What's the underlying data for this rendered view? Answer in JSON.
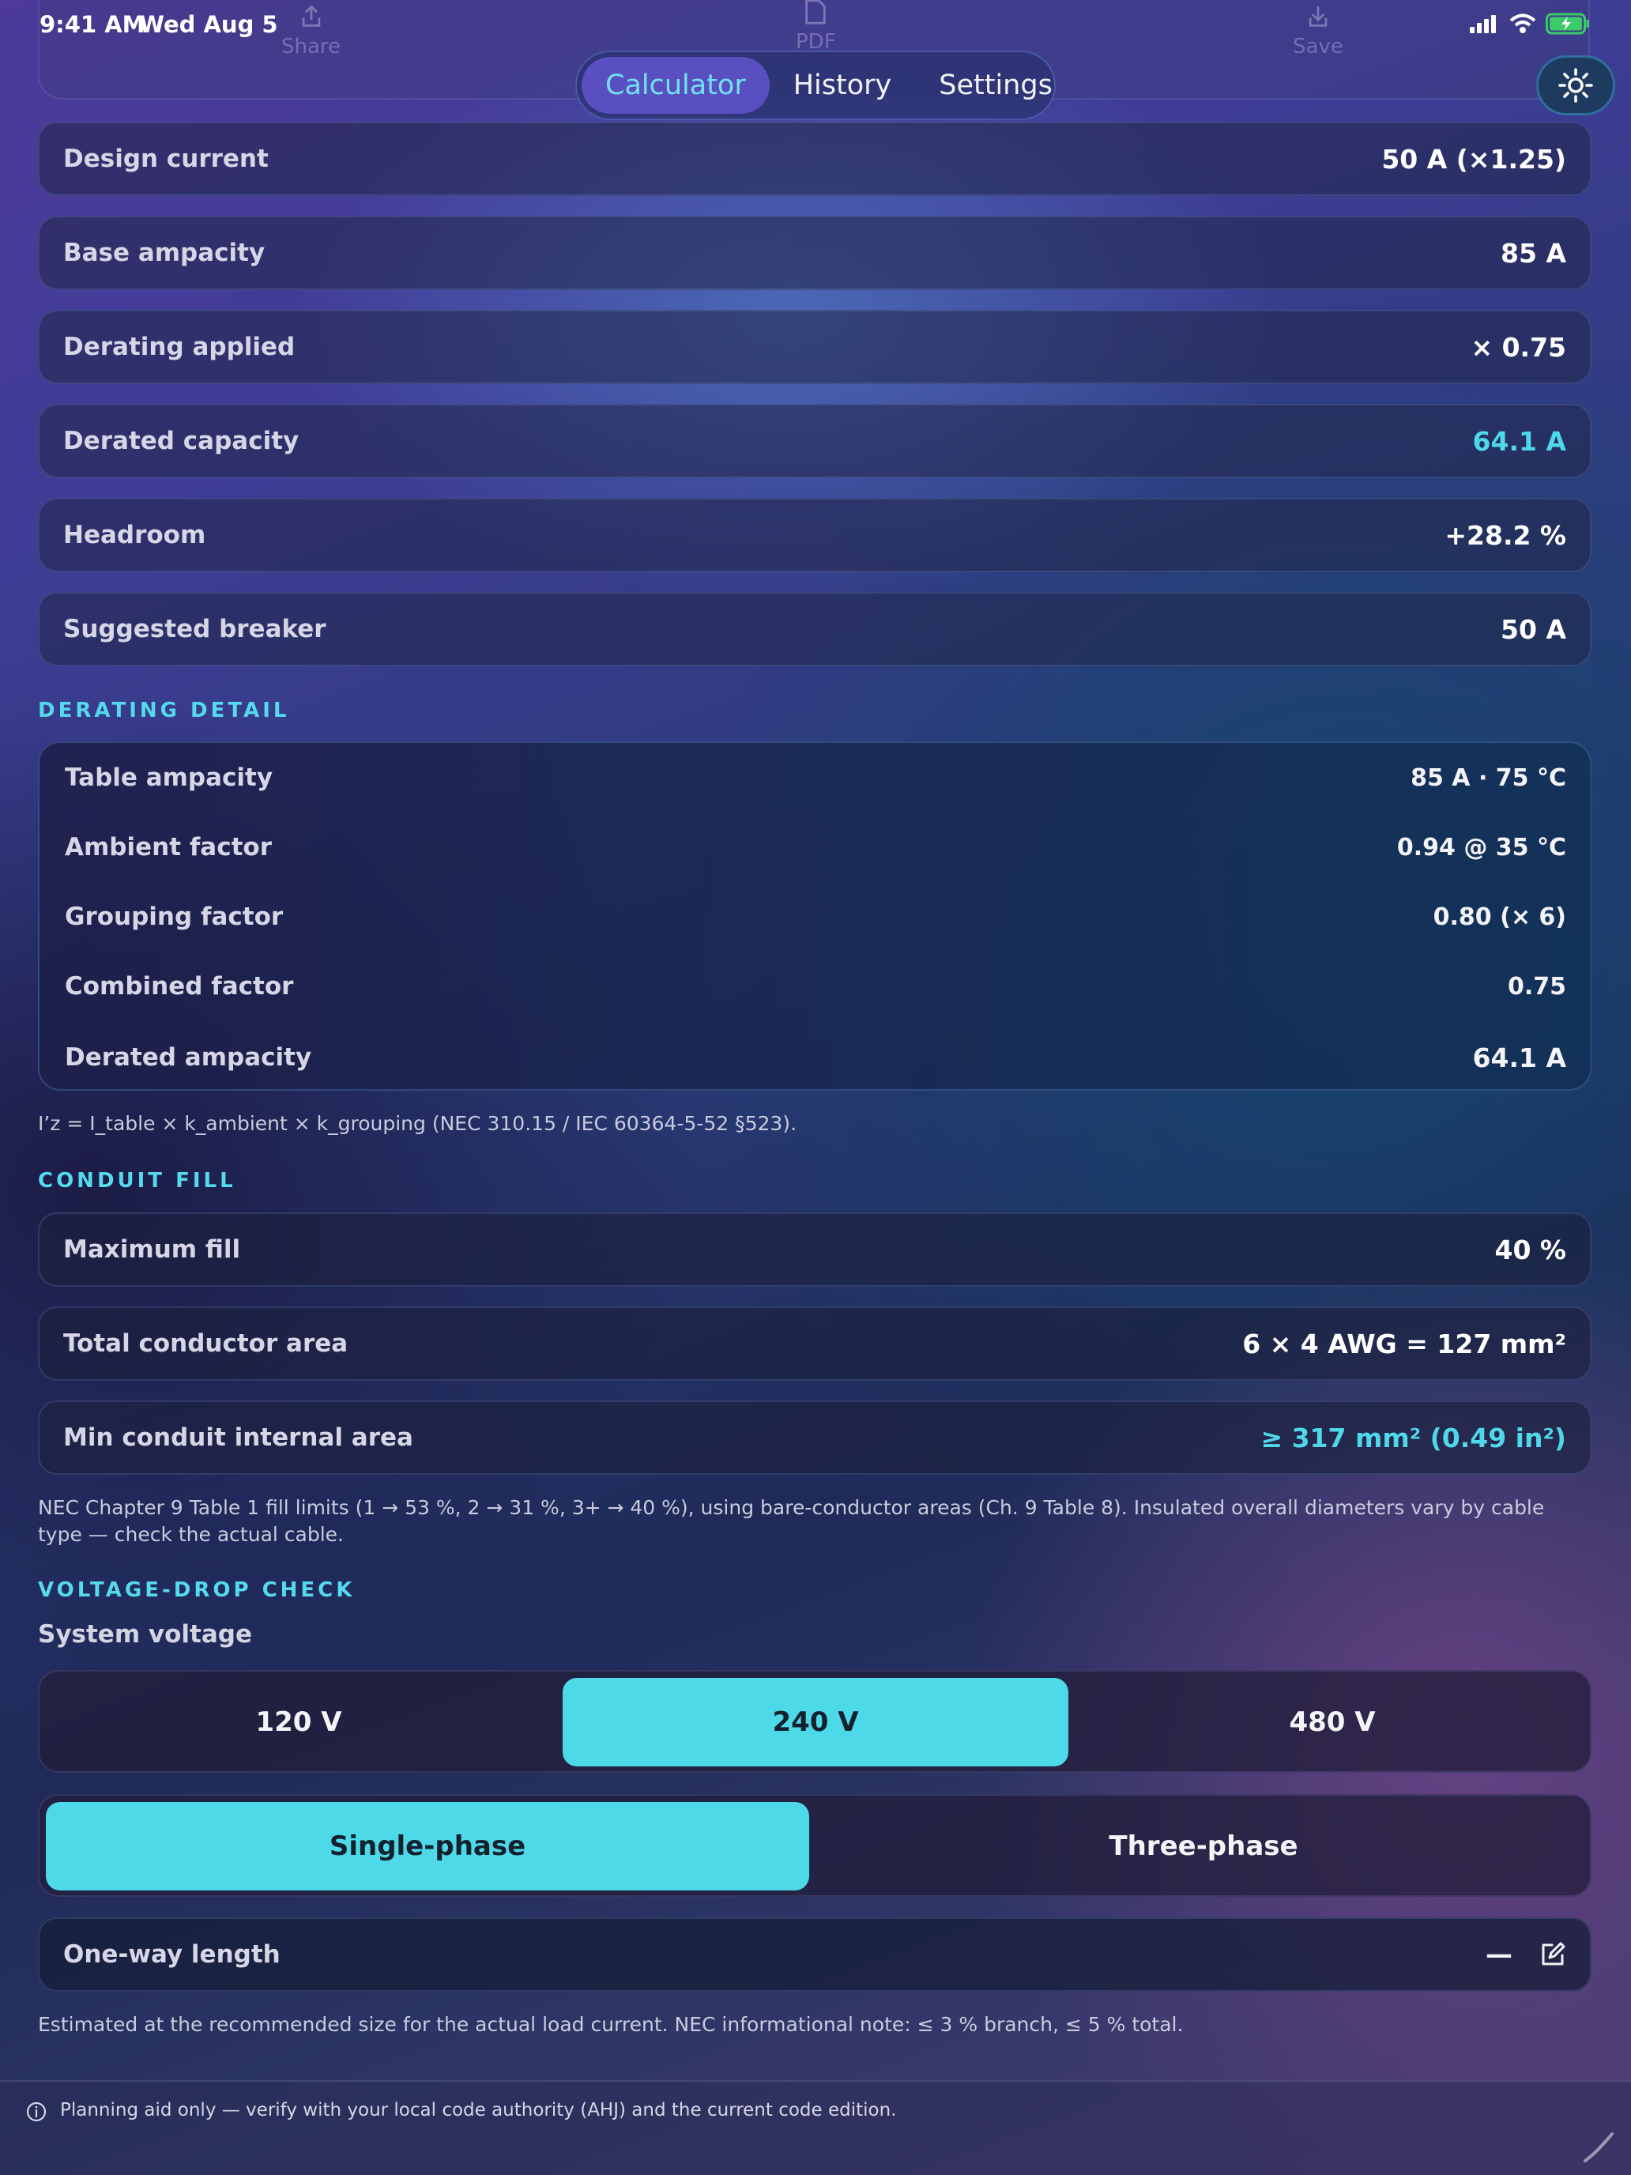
{
  "status_bar": {
    "time": "9:41 AM",
    "date": "Wed Aug 5"
  },
  "toolbar": {
    "share_label": "Share",
    "pdf_label": "PDF",
    "save_label": "Save"
  },
  "nav": {
    "tabs": [
      {
        "label": "Calculator",
        "active": true
      },
      {
        "label": "History",
        "active": false
      },
      {
        "label": "Settings",
        "active": false
      }
    ]
  },
  "results": [
    {
      "label": "Design current",
      "value": "50 A (×1.25)"
    },
    {
      "label": "Base ampacity",
      "value": "85 A"
    },
    {
      "label": "Derating applied",
      "value": "× 0.75"
    },
    {
      "label": "Derated capacity",
      "value": "64.1 A",
      "accent": true
    },
    {
      "label": "Headroom",
      "value": "+28.2 %"
    },
    {
      "label": "Suggested breaker",
      "value": "50 A"
    }
  ],
  "derating": {
    "heading": "DERATING DETAIL",
    "rows": [
      {
        "label": "Table ampacity",
        "value": "85 A · 75 °C"
      },
      {
        "label": "Ambient factor",
        "value": "0.94 @ 35 °C"
      },
      {
        "label": "Grouping factor",
        "value": "0.80 (× 6)"
      },
      {
        "label": "Combined factor",
        "value": "0.75"
      },
      {
        "label": "Derated ampacity",
        "value": "64.1 A"
      }
    ],
    "note": "I’z = I_table × k_ambient × k_grouping (NEC 310.15 / IEC 60364-5-52 §523)."
  },
  "conduit": {
    "heading": "CONDUIT FILL",
    "rows": [
      {
        "label": "Maximum fill",
        "value": "40 %"
      },
      {
        "label": "Total conductor area",
        "value": "6 × 4 AWG = 127 mm²"
      },
      {
        "label": "Min conduit internal area",
        "value": "≥ 317 mm² (0.49 in²)",
        "accent": true
      }
    ],
    "note": "NEC Chapter 9 Table 1 fill limits (1 → 53 %, 2 → 31 %, 3+ → 40 %), using bare-conductor areas (Ch. 9 Table 8). Insulated overall diameters vary by cable type — check the actual cable."
  },
  "voltage_drop": {
    "heading": "VOLTAGE-DROP CHECK",
    "system_voltage_label": "System voltage",
    "voltages": [
      "120 V",
      "240 V",
      "480 V"
    ],
    "selected_voltage": "240 V",
    "phases": [
      "Single-phase",
      "Three-phase"
    ],
    "selected_phase": "Single-phase",
    "length_label": "One-way length",
    "length_value": "—",
    "note": "Estimated at the recommended size for the actual load current. NEC informational note: ≤ 3 % branch, ≤ 5 % total."
  },
  "footer": {
    "text": "Planning aid only — verify with your local code authority (AHJ) and the current code edition."
  },
  "colors": {
    "accent": "#4dd9e8",
    "nav_active": "#5a4fc0",
    "battery": "#3ccb6a"
  },
  "icons": [
    "signal-icon",
    "wifi-icon",
    "battery-icon",
    "share-icon",
    "pdf-icon",
    "save-icon",
    "sun-icon",
    "edit-icon",
    "info-icon",
    "spinner-icon"
  ]
}
